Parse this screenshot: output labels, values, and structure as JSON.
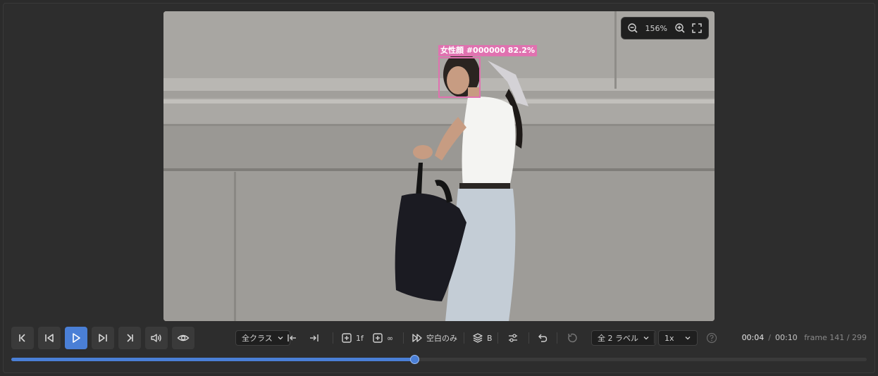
{
  "video": {
    "zoom_level": "156%",
    "detection": {
      "label": "女性顔 #000000 82.2%",
      "color": "#e072b0"
    }
  },
  "controls": {
    "class_filter": "全クラス",
    "step_1f_label": "1f",
    "step_inf_label": "∞",
    "blank_only_label": "空白のみ",
    "layers_label": "B",
    "labels_filter": "全 2 ラベル",
    "speed": "1x"
  },
  "time": {
    "current": "00:04",
    "separator": "/",
    "total": "00:10",
    "frame_text": "frame 141 / 299",
    "progress": 0.471
  },
  "colors": {
    "accent": "#4a7fd6",
    "background": "#2b2b2b"
  }
}
